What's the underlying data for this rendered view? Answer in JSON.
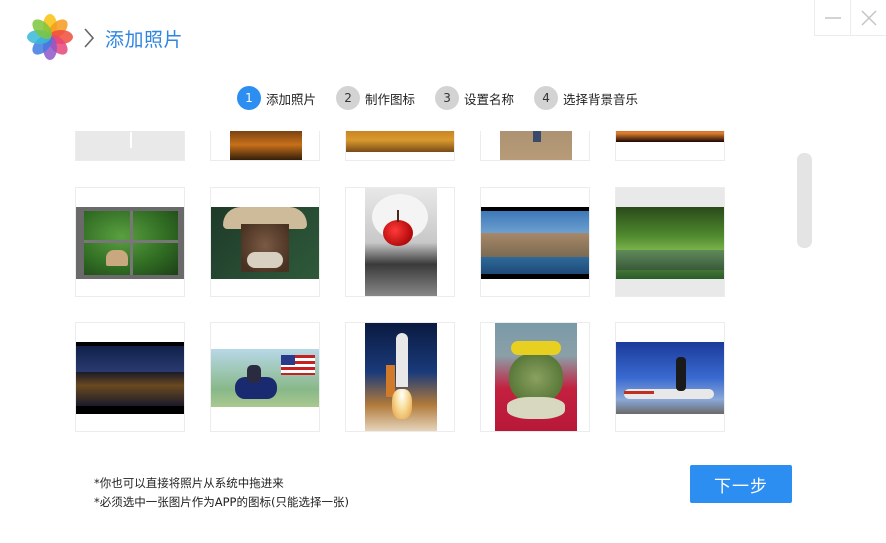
{
  "header": {
    "title": "添加照片",
    "logo_icon": "photos-flower-icon",
    "chevron_icon": "chevron-right-icon"
  },
  "window": {
    "minimize_icon": "minimize-icon",
    "close_icon": "close-icon"
  },
  "steps": [
    {
      "num": "1",
      "label": "添加照片",
      "active": true
    },
    {
      "num": "2",
      "label": "制作图标",
      "active": false
    },
    {
      "num": "3",
      "label": "设置名称",
      "active": false
    },
    {
      "num": "4",
      "label": "选择背景音乐",
      "active": false
    }
  ],
  "photos": [
    {
      "subject": "partial-top-gray"
    },
    {
      "subject": "partial-top-fire"
    },
    {
      "subject": "partial-top-field"
    },
    {
      "subject": "partial-top-people"
    },
    {
      "subject": "partial-top-sunset"
    },
    {
      "subject": "cat-at-window"
    },
    {
      "subject": "old-man-cowboy-hat"
    },
    {
      "subject": "cherry-in-cream"
    },
    {
      "subject": "coastal-town"
    },
    {
      "subject": "forest-river"
    },
    {
      "subject": "canal-night"
    },
    {
      "subject": "motorcycle-flag"
    },
    {
      "subject": "space-shuttle-launch"
    },
    {
      "subject": "frog-cake"
    },
    {
      "subject": "airplane-jump"
    }
  ],
  "footer": {
    "note1": "*你也可以直接将照片从系统中拖进来",
    "note2": "*必须选中一张图片作为APP的图标(只能选择一张)",
    "next_label": "下一步"
  },
  "colors": {
    "accent": "#2b8ef0",
    "title": "#2f86e0",
    "step_inactive": "#d3d3d3"
  }
}
